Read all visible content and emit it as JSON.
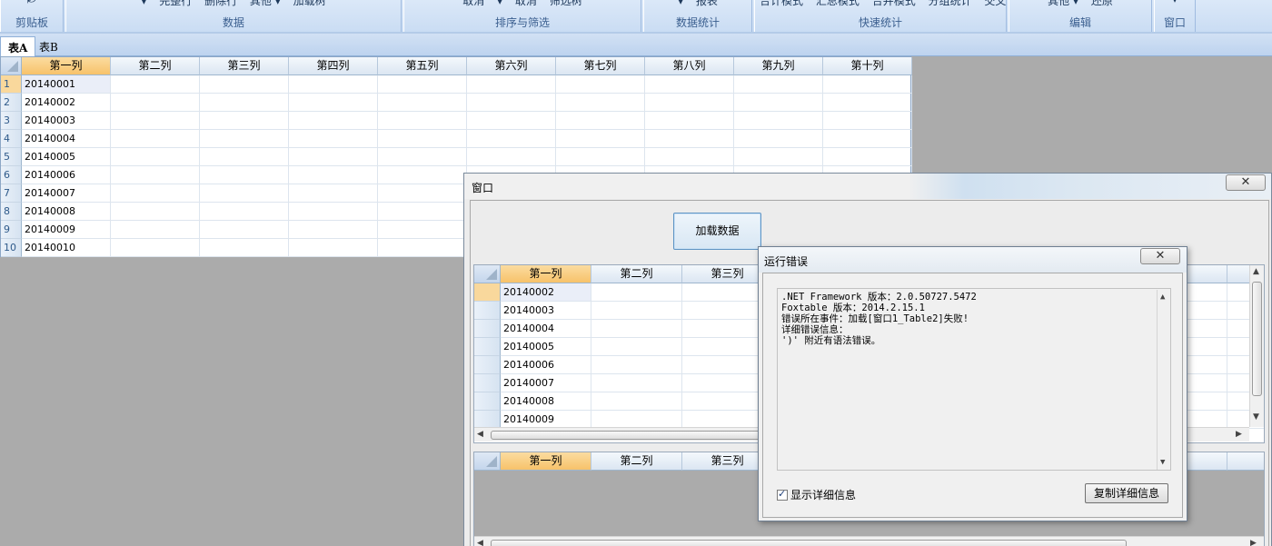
{
  "ribbon": {
    "groups": [
      {
        "label": "剪贴板",
        "cmds": []
      },
      {
        "label": "数据",
        "cmds": [
          "▾",
          "完整行",
          "删除行",
          "其他 ▾",
          "加载树"
        ]
      },
      {
        "label": "排序与筛选",
        "cmds": [
          "取消",
          "▾",
          "取消",
          "筛选树"
        ]
      },
      {
        "label": "数据统计",
        "cmds": [
          "▾",
          "报表"
        ]
      },
      {
        "label": "快速统计",
        "cmds": [
          "合计模式",
          "汇总模式",
          "合并模式",
          "分组统计",
          "交叉统计"
        ]
      },
      {
        "label": "编辑",
        "cmds": [
          "其他 ▾",
          "还原"
        ]
      },
      {
        "label": "窗口",
        "cmds": [
          "▾"
        ]
      }
    ]
  },
  "sheet_tabs": [
    "表A",
    "表B"
  ],
  "main_grid": {
    "columns": [
      "第一列",
      "第二列",
      "第三列",
      "第四列",
      "第五列",
      "第六列",
      "第七列",
      "第八列",
      "第九列",
      "第十列"
    ],
    "row_numbers": [
      "1",
      "2",
      "3",
      "4",
      "5",
      "6",
      "7",
      "8",
      "9",
      "10"
    ],
    "first_col_values": [
      "20140001",
      "20140002",
      "20140003",
      "20140004",
      "20140005",
      "20140006",
      "20140007",
      "20140008",
      "20140009",
      "20140010"
    ]
  },
  "window": {
    "title": "窗口",
    "close_glyph": "✕",
    "load_button": "加载数据",
    "grid1": {
      "columns": [
        "第一列",
        "第二列",
        "第三列",
        "",
        "",
        "",
        "",
        "",
        "列"
      ],
      "values": [
        "20140002",
        "20140003",
        "20140004",
        "20140005",
        "20140006",
        "20140007",
        "20140008",
        "20140009"
      ]
    },
    "grid2": {
      "columns": [
        "第一列",
        "第二列",
        "第三列",
        "",
        "",
        "",
        "",
        "",
        "列",
        "第"
      ]
    }
  },
  "error_dialog": {
    "title": "运行错误",
    "close_glyph": "✕",
    "lines": [
      ".NET Framework 版本：2.0.50727.5472",
      "Foxtable 版本：2014.2.15.1",
      "错误所在事件：加载[窗口1_Table2]失败!",
      "详细错误信息：",
      "')' 附近有语法错误。"
    ],
    "show_detail_label": "显示详细信息",
    "show_detail_checked": true,
    "copy_button": "复制详细信息"
  }
}
